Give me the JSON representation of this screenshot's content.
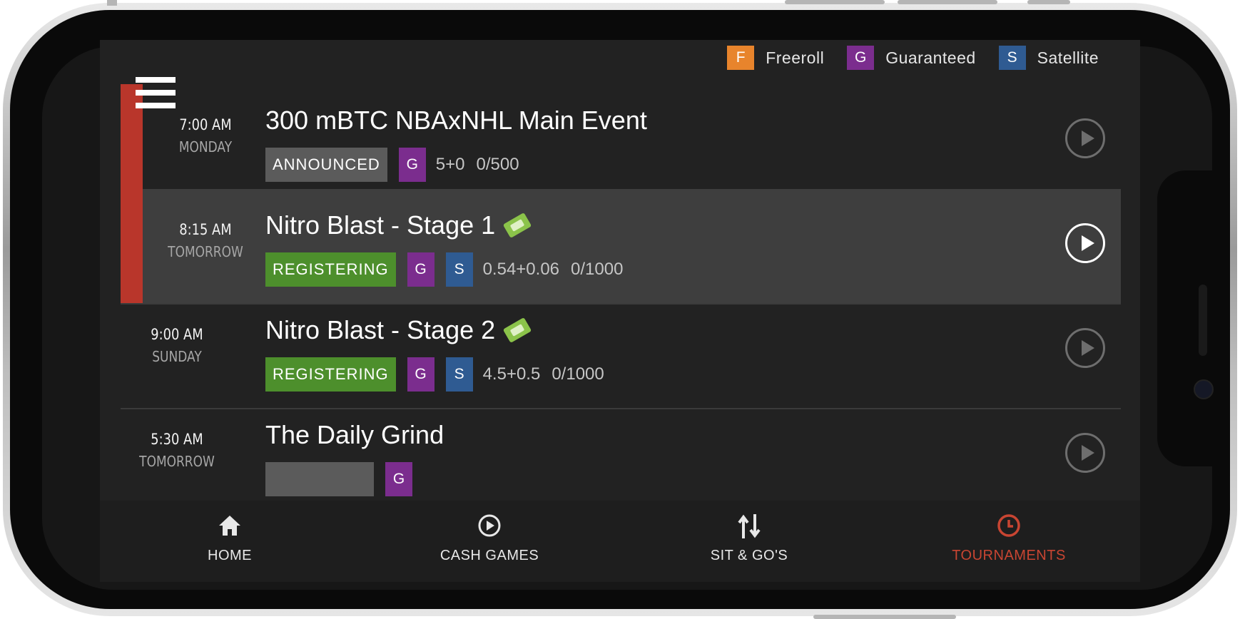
{
  "legend": [
    {
      "letter": "F",
      "label": "Freeroll",
      "color": "#e8842c"
    },
    {
      "letter": "G",
      "label": "Guaranteed",
      "color": "#7b2d8e"
    },
    {
      "letter": "S",
      "label": "Satellite",
      "color": "#2f5b92"
    }
  ],
  "tournaments": [
    {
      "time": "7:00 AM",
      "day": "MONDAY",
      "title": "300 mBTC NBAxNHL Main Event",
      "status": "ANNOUNCED",
      "tags": [
        "G"
      ],
      "buyin": "5+0",
      "players": "0/500"
    },
    {
      "time": "8:15 AM",
      "day": "TOMORROW",
      "title": "Nitro Blast - Stage 1",
      "status": "REGISTERING",
      "tags": [
        "G",
        "S"
      ],
      "buyin": "0.54+0.06",
      "players": "0/1000"
    },
    {
      "time": "9:00 AM",
      "day": "SUNDAY",
      "title": "Nitro Blast - Stage 2",
      "status": "REGISTERING",
      "tags": [
        "G",
        "S"
      ],
      "buyin": "4.5+0.5",
      "players": "0/1000"
    },
    {
      "time": "5:30 AM",
      "day": "TOMORROW",
      "title": "The Daily Grind",
      "status": "",
      "tags": [
        "G"
      ],
      "buyin": "",
      "players": ""
    }
  ],
  "tabs": [
    {
      "label": "HOME",
      "icon": "home-icon"
    },
    {
      "label": "CASH GAMES",
      "icon": "play-circle-icon"
    },
    {
      "label": "SIT & GO'S",
      "icon": "sort-arrows-icon"
    },
    {
      "label": "TOURNAMENTS",
      "icon": "clock-icon"
    }
  ],
  "colors": {
    "accent": "#c84532",
    "registering": "#4d8f2c",
    "announced": "#5b5b5b",
    "bar": "#b9362b"
  }
}
